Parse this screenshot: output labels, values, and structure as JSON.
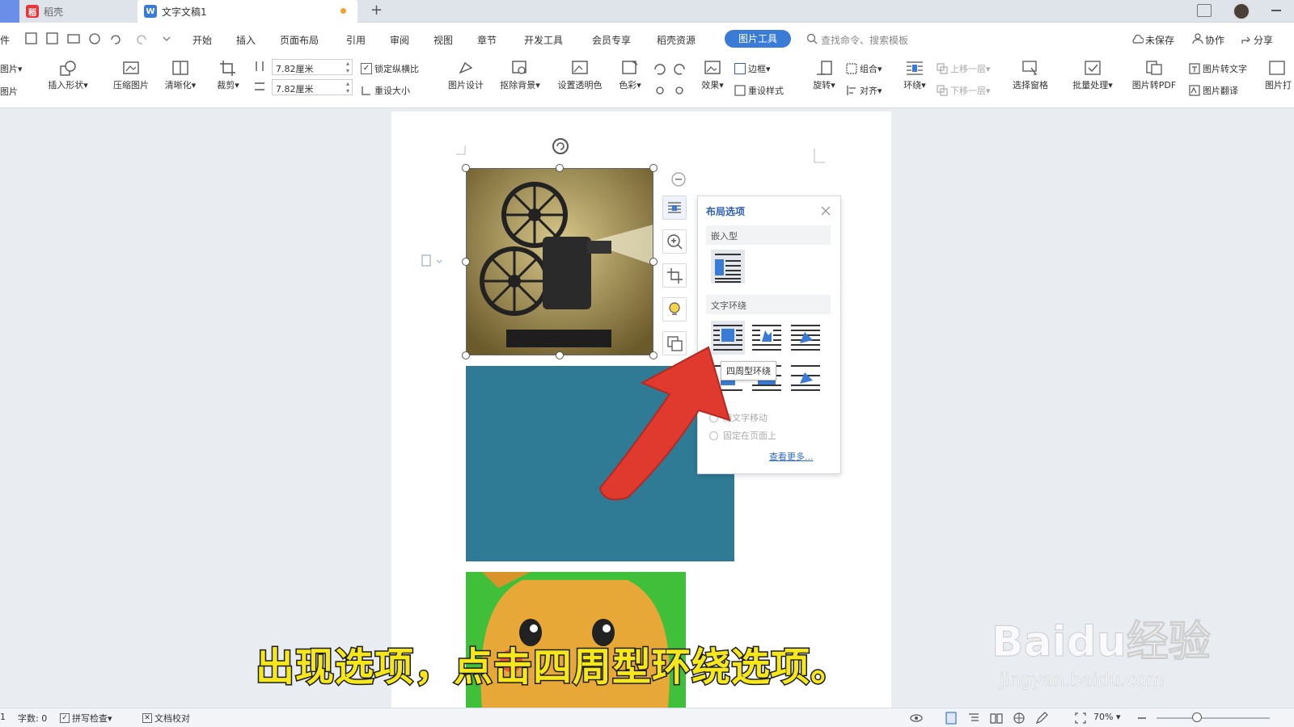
{
  "tabs": [
    {
      "label": "稻壳"
    },
    {
      "label": "文字文稿1"
    }
  ],
  "new_tab": "+",
  "menu": {
    "items": [
      "开始",
      "插入",
      "页面布局",
      "引用",
      "审阅",
      "视图",
      "章节",
      "开发工具",
      "会员专享",
      "稻壳资源"
    ],
    "active": "图片工具",
    "search_placeholder": "查找命令、搜索模板",
    "right": [
      "未保存",
      "协作",
      "分享"
    ]
  },
  "ribbon": {
    "left_cut": [
      "图片",
      "图片"
    ],
    "insert_shape": "插入形状",
    "compress": "压缩图片",
    "sharpen": "清晰化",
    "crop": "裁剪",
    "width": "7.82厘米",
    "height": "7.82厘米",
    "lock_ratio": "锁定纵横比",
    "reset_size": "重设大小",
    "pic_design": "图片设计",
    "remove_bg": "抠除背景",
    "set_transparent": "设置透明色",
    "color": "色彩",
    "effects": "效果",
    "border": "边框",
    "reset_style": "重设样式",
    "rotate": "旋转",
    "group": "组合",
    "align": "对齐",
    "wrap": "环绕",
    "bring_forward": "上移一层",
    "send_backward": "下移一层",
    "selection_pane": "选择窗格",
    "batch": "批量处理",
    "to_pdf": "图片转PDF",
    "to_text": "图片转文字",
    "translate": "图片翻译",
    "print_cut": "图片打"
  },
  "layout_panel": {
    "title": "布局选项",
    "inline_label": "嵌入型",
    "wrap_label": "文字环绕",
    "tooltip": "四周型环绕",
    "move_with_text": "随文字移动",
    "fix_on_page": "固定在页面上",
    "see_more": "查看更多..."
  },
  "statusbar": {
    "page_cut": "1",
    "word_count": "字数: 0",
    "spell_check": "拼写检查",
    "doc_check": "文档校对",
    "zoom": "70%"
  },
  "subtitle": "出现选项，点击四周型环绕选项。",
  "watermark": {
    "brand": "Baidu经验",
    "url": "jingyan.baidu.com"
  },
  "colors": {
    "accent": "#3a7bd5",
    "teal_block": "#2f7b96",
    "pikachu_bg": "#3fbf3a",
    "arrow": "#e03a2f",
    "subtitle": "#f5e71a"
  }
}
